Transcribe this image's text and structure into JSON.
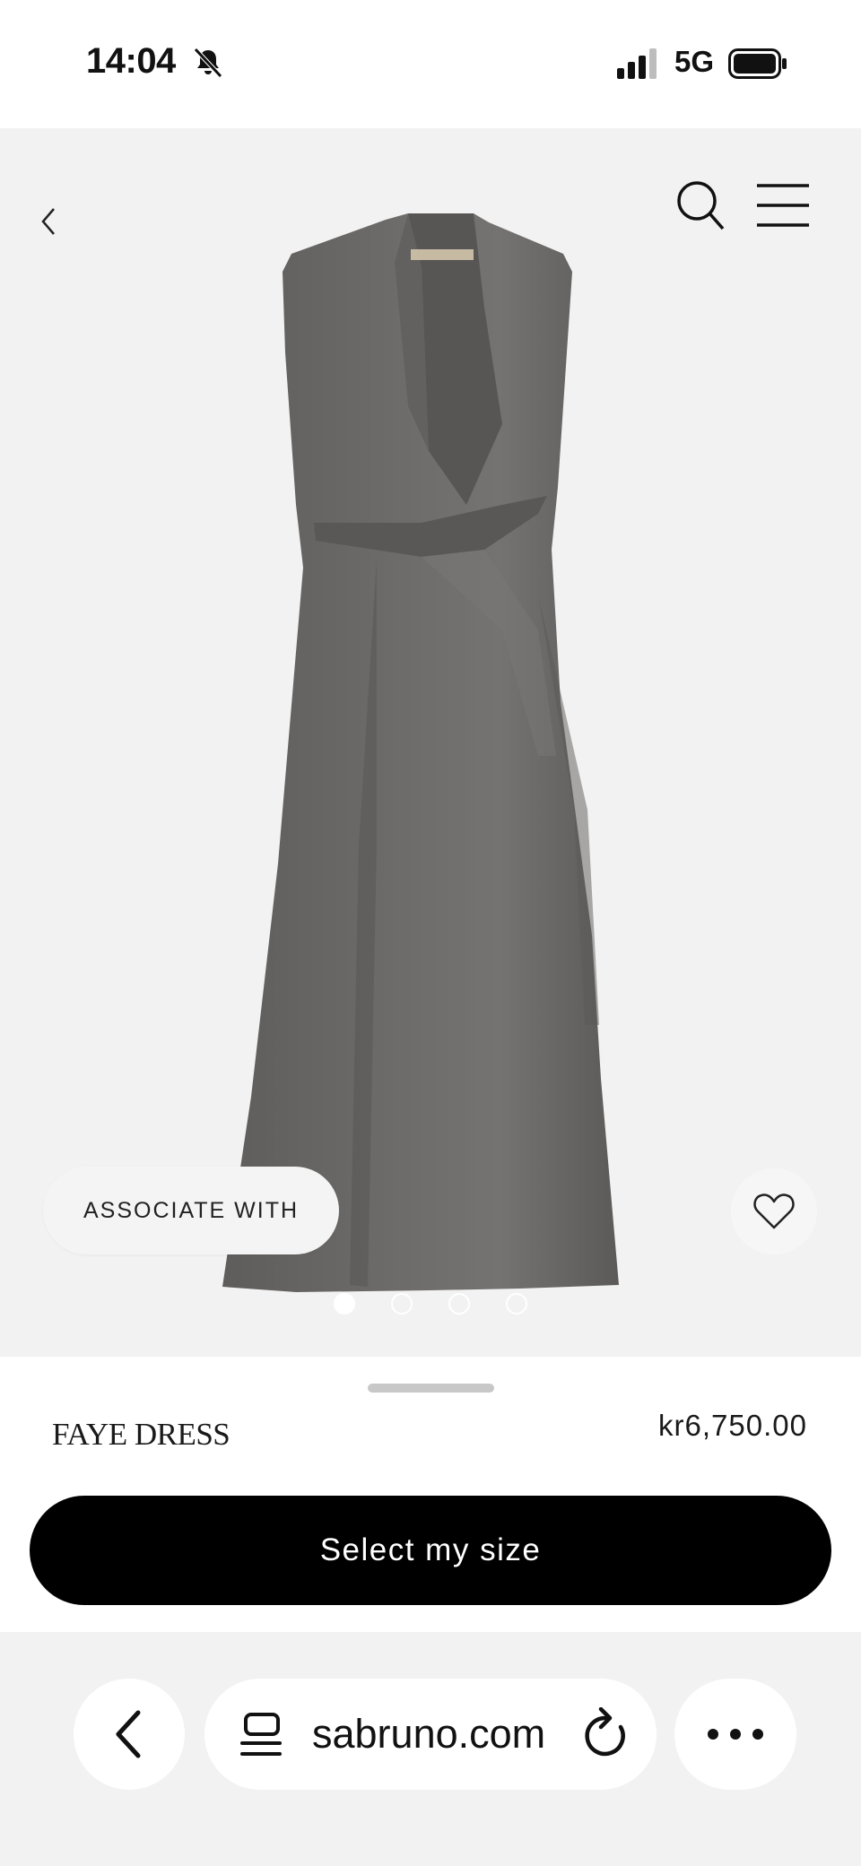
{
  "status_bar": {
    "time": "14:04",
    "network": "5G",
    "icons": [
      "bell-slash-icon",
      "signal-icon",
      "battery-icon"
    ]
  },
  "hero": {
    "image": "grey-wrap-dress",
    "associate_label": "ASSOCIATE WITH",
    "carousel": {
      "total": 4,
      "active": 1
    },
    "icons": [
      "chevron-left-icon",
      "search-icon",
      "hamburger-menu-icon",
      "heart-icon"
    ]
  },
  "product": {
    "name": "FAYE DRESS",
    "price": "kr6,750.00",
    "cta_label": "Select my size"
  },
  "browser": {
    "url": "sabruno.com",
    "icons": [
      "back-arrow-icon",
      "tabs-icon",
      "reload-icon",
      "more-icon"
    ]
  },
  "colors": {
    "hero_background": "#f2f2f2",
    "dress": "#6a6866",
    "cta_background": "#000000",
    "cta_text": "#ffffff"
  }
}
